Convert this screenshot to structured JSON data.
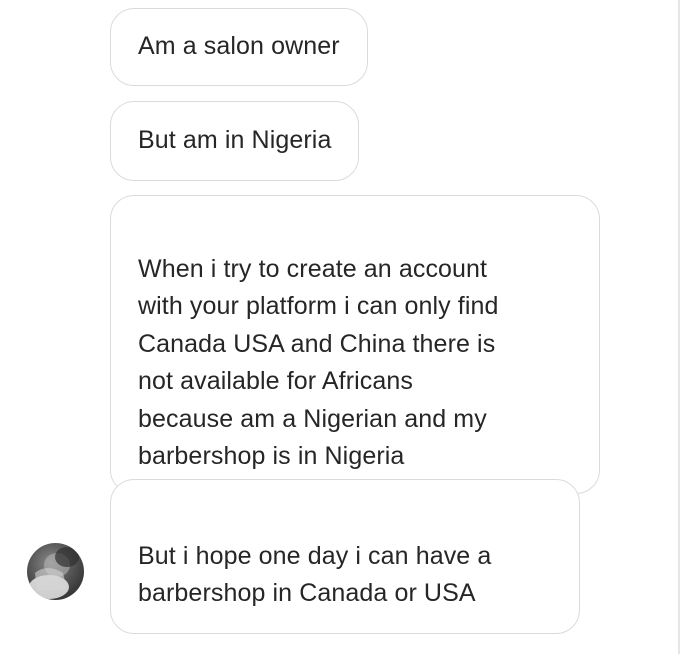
{
  "thread": {
    "messages": [
      {
        "text": "Am a salon owner"
      },
      {
        "text": "But am in Nigeria"
      },
      {
        "text": "When i try to create an account\nwith your platform i can only find\nCanada USA and China there is\nnot available for Africans\nbecause am a Nigerian and my\nbarbershop is in Nigeria"
      },
      {
        "text": "But i hope one day i can have a\nbarbershop in Canada or USA"
      }
    ]
  },
  "colors": {
    "bubble_border": "#dbdbdb",
    "text": "#262626",
    "background": "#ffffff"
  },
  "icons": {
    "avatar": "sender-avatar-photo"
  }
}
